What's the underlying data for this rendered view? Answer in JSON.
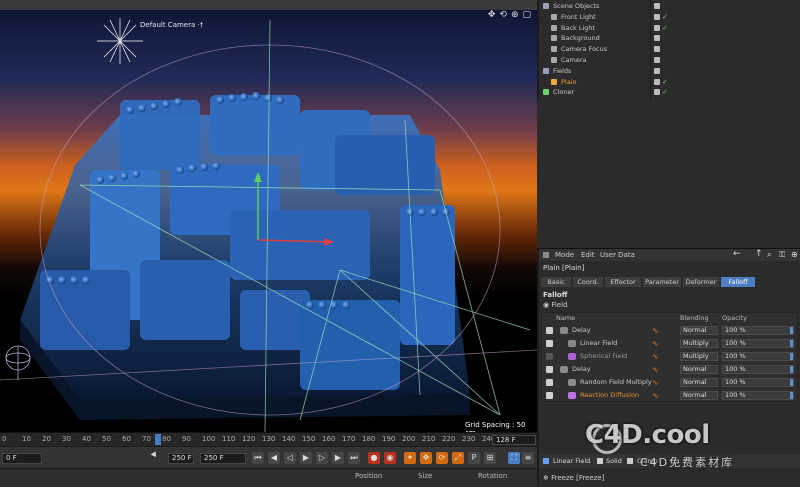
{
  "viewport": {
    "camera_label": "Default Camera ·†",
    "grid_spacing": "Grid Spacing : 50 cm",
    "nav_icons": [
      "move-icon",
      "rotate-icon",
      "zoom-icon",
      "maximize-icon"
    ]
  },
  "timeline": {
    "ticks": [
      "0",
      "10",
      "20",
      "30",
      "40",
      "50",
      "60",
      "70",
      "80",
      "90",
      "100",
      "110",
      "120",
      "130",
      "140",
      "150",
      "160",
      "170",
      "180",
      "190",
      "200",
      "210",
      "220",
      "230",
      "240",
      "250"
    ],
    "current_frame": "0 F",
    "start_field": "250 F",
    "end_field": "250 F",
    "max_frame": "128 F"
  },
  "coords": {
    "position": "Position",
    "size": "Size",
    "rotation": "Rotation"
  },
  "objects": [
    {
      "name": "Scene Objects",
      "indent": 0,
      "tick": false,
      "color": "#9aa0b8"
    },
    {
      "name": "Front Light",
      "indent": 1,
      "tick": true,
      "color": "#aaaaaa"
    },
    {
      "name": "Back Light",
      "indent": 1,
      "tick": true,
      "color": "#aaaaaa"
    },
    {
      "name": "Background",
      "indent": 1,
      "tick": false,
      "color": "#aaaaaa"
    },
    {
      "name": "Camera Focus",
      "indent": 1,
      "tick": false,
      "color": "#aaaaaa"
    },
    {
      "name": "Camera",
      "indent": 1,
      "tick": false,
      "color": "#aaaaaa"
    },
    {
      "name": "Fields",
      "indent": 0,
      "tick": false,
      "color": "#9aa0b8"
    },
    {
      "name": "Plain",
      "indent": 1,
      "tick": true,
      "color": "#f0a838"
    },
    {
      "name": "Cloner",
      "indent": 0,
      "tick": true,
      "color": "#6fd06f"
    }
  ],
  "attr": {
    "menu": [
      "Mode",
      "Edit",
      "User Data"
    ],
    "title": "Plain [Plain]",
    "tabs": [
      "Basic",
      "Coord.",
      "Effector",
      "Parameter",
      "Deformer",
      "Falloff"
    ],
    "active_tab": "Falloff",
    "section": "Falloff",
    "field_label": "Field",
    "headers": {
      "name": "Name",
      "blending": "Blending",
      "opacity": "Opacity"
    },
    "fields": [
      {
        "name": "Delay",
        "checked": true,
        "indent": 0,
        "blend": "Normal",
        "opacity": "100 %",
        "color": "#c8c8c8"
      },
      {
        "name": "Linear Field",
        "checked": true,
        "indent": 1,
        "blend": "Multiply",
        "opacity": "100 %",
        "color": "#c8c8c8"
      },
      {
        "name": "Spherical Field",
        "checked": false,
        "indent": 1,
        "blend": "Multiply",
        "opacity": "100 %",
        "color": "#c8c8c8"
      },
      {
        "name": "Delay",
        "checked": true,
        "indent": 0,
        "blend": "Normal",
        "opacity": "100 %",
        "color": "#c8c8c8"
      },
      {
        "name": "Random Field Multiply",
        "checked": true,
        "indent": 1,
        "blend": "Normal",
        "opacity": "100 %",
        "color": "#c8c8c8"
      },
      {
        "name": "Reaction Diffusion",
        "checked": true,
        "indent": 1,
        "blend": "Normal",
        "opacity": "100 %",
        "color": "#e89030"
      }
    ],
    "bottom_items": [
      "Linear Field",
      "Solid",
      "Clamp"
    ],
    "freeze": "Freeze [Freeze]"
  },
  "watermark": {
    "text": "C4D.cool",
    "sub": "C4D免费素材库"
  }
}
